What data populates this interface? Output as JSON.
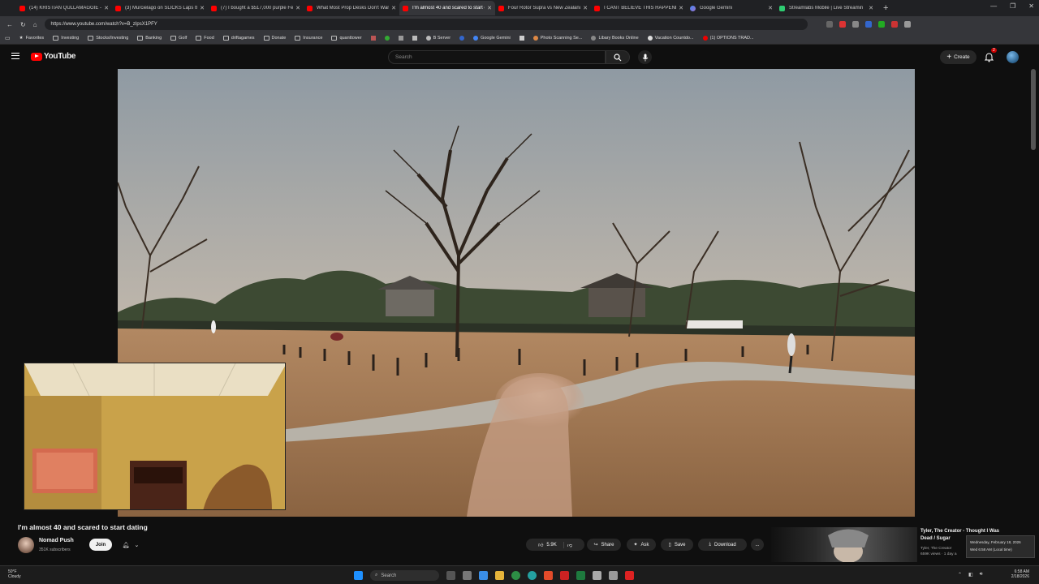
{
  "browser": {
    "tabs": [
      {
        "title": "(14) KRISTIAN QULLAMAGGIE - M",
        "icon": "youtube-favicon"
      },
      {
        "title": "(3) Murcielago on SLICKS Laps the",
        "icon": "youtube-favicon"
      },
      {
        "title": "(7) I bought a $517,000 purple Fer",
        "icon": "youtube-favicon"
      },
      {
        "title": "What Most Prop Desks Don't Wan",
        "icon": "youtube-favicon"
      },
      {
        "title": "I'm almost 40 and scared to start d",
        "icon": "youtube-favicon",
        "active": true
      },
      {
        "title": "Four Rotor Supra vs New Zealand",
        "icon": "youtube-favicon"
      },
      {
        "title": "I CANT BELIEVE THIS HAPPENED",
        "icon": "youtube-favicon"
      },
      {
        "title": "Google Gemini",
        "icon": "gemini-favicon"
      },
      {
        "title": "Streamlabs Mobile | Live Streamin",
        "icon": "streamlabs-favicon"
      }
    ],
    "url": "https://www.youtube.com/watch?v=B_zIpsX1PFY",
    "bookmarks": [
      {
        "label": "Favorites",
        "type": "star"
      },
      {
        "label": "Investing",
        "type": "folder"
      },
      {
        "label": "Stocks/Investing",
        "type": "folder"
      },
      {
        "label": "Banking",
        "type": "folder"
      },
      {
        "label": "Golf",
        "type": "folder"
      },
      {
        "label": "Food",
        "type": "folder"
      },
      {
        "label": "driftagames",
        "type": "folder"
      },
      {
        "label": "Donate",
        "type": "folder"
      },
      {
        "label": "Insurance",
        "type": "folder"
      },
      {
        "label": "quanttower",
        "type": "folder"
      },
      {
        "label": "B Server",
        "type": "site"
      },
      {
        "label": "Google Gemini",
        "type": "site"
      },
      {
        "label": "Photo Scanning Se...",
        "type": "site"
      },
      {
        "label": "Libary Books Online",
        "type": "site"
      },
      {
        "label": "Vacation Countdo...",
        "type": "site"
      },
      {
        "label": "(1) OPTIONS TRAD...",
        "type": "site"
      }
    ]
  },
  "youtube": {
    "logo_text": "YouTube",
    "search_placeholder": "Search",
    "create_label": "Create",
    "notification_count": "2",
    "video_title": "I'm almost 40 and scared to start dating",
    "channel_name": "Nomad Push",
    "subscribers": "351K subscribers",
    "join_label": "Join",
    "likes": "5.9K",
    "share_label": "Share",
    "ask_label": "Ask",
    "save_label": "Save",
    "download_label": "Download",
    "more_label": "...",
    "related": {
      "title": "Tyler, The Creator - Thought I Was Dead / Sugar",
      "channel": "Tyler, The Creator",
      "meta": "659K views · 1 day a"
    },
    "tooltip": {
      "line1": "Wednesday, February 18, 2026",
      "line2": "Wed 6:58 AM (Local time)"
    }
  },
  "taskbar": {
    "weather_temp": "50°F",
    "weather_desc": "Cloudy",
    "search_label": "Search",
    "time": "6:58 AM",
    "date": "2/18/2026"
  },
  "colors": {
    "accent": "#ff0000",
    "background": "#0f0f0f"
  }
}
